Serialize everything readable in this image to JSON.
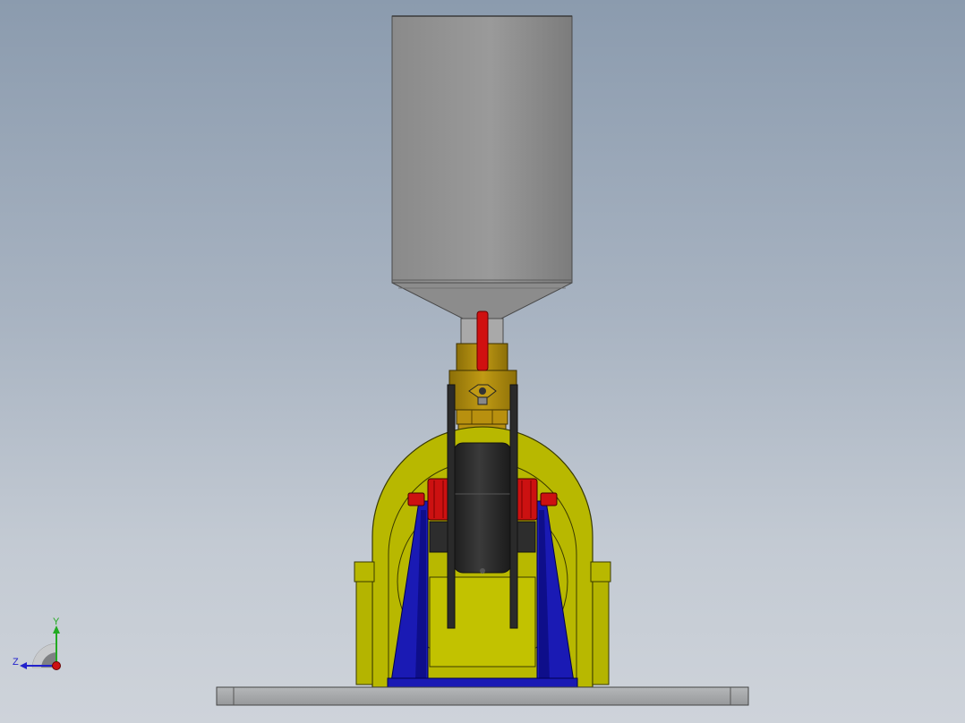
{
  "viewport": {
    "colors": {
      "background_top": "#8b9bae",
      "background_bottom": "#ced3da",
      "hopper": "#8f8f8f",
      "valve_body": "#a8860d",
      "valve_handle": "#d01010",
      "housing": "#b8b800",
      "stand": "#1a1ab4",
      "roller": "#2a2a2a",
      "bearing": "#cc1111",
      "base_plate": "#a6a8aa"
    }
  },
  "triad": {
    "y_label": "Y",
    "z_label": "Z",
    "y_color": "#22aa22",
    "z_color": "#2222cc",
    "x_color": "#cc1111"
  }
}
